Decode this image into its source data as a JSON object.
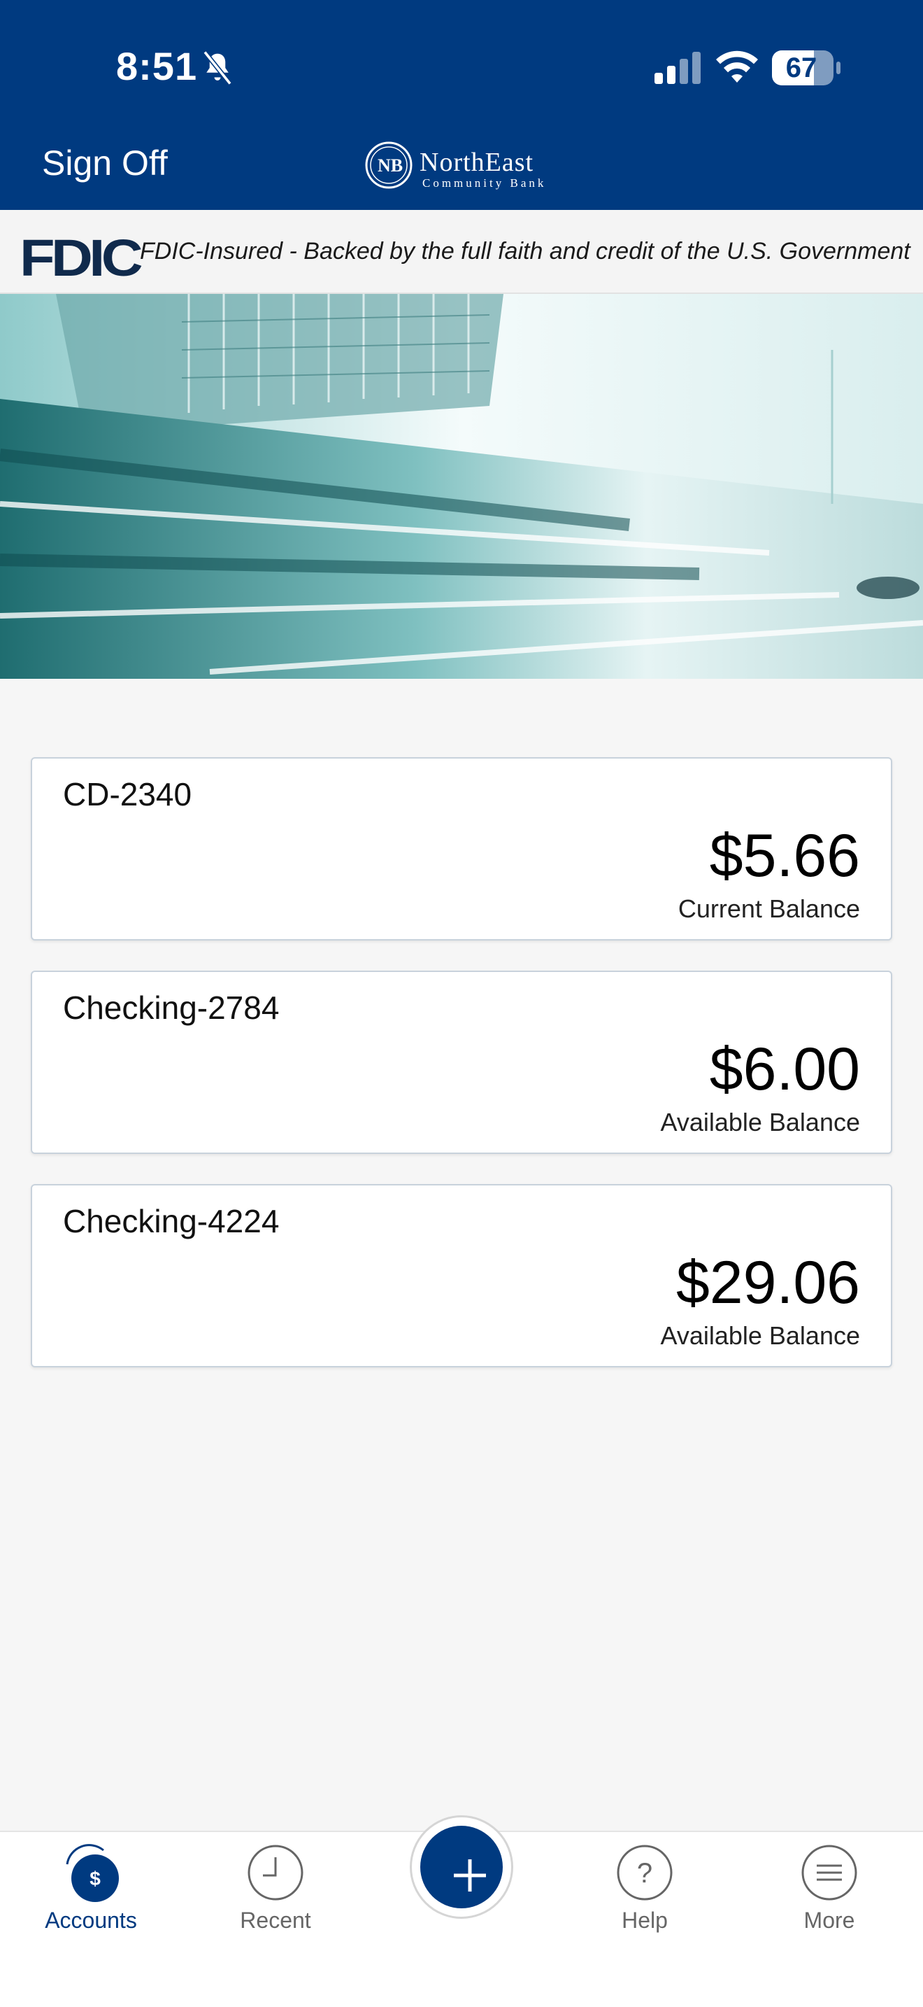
{
  "status_bar": {
    "time": "8:51",
    "battery": "67",
    "icons": [
      "bell-slash-icon",
      "cellular-signal-icon",
      "wifi-icon",
      "battery-icon"
    ]
  },
  "header": {
    "sign_off_label": "Sign Off",
    "logo_name": "NorthEast",
    "logo_subtitle": "Community Bank"
  },
  "fdic": {
    "logo": "FDIC",
    "text": "FDIC-Insured - Backed by the full faith and credit of the U.S. Government"
  },
  "accounts": [
    {
      "name": "CD-2340",
      "amount": "$5.66",
      "label": "Current Balance"
    },
    {
      "name": "Checking-2784",
      "amount": "$6.00",
      "label": "Available Balance"
    },
    {
      "name": "Checking-4224",
      "amount": "$29.06",
      "label": "Available Balance"
    }
  ],
  "tabbar": {
    "items": [
      {
        "label": "Accounts",
        "icon": "accounts-dollar-icon",
        "active": true
      },
      {
        "label": "Recent",
        "icon": "clock-icon",
        "active": false
      },
      {
        "label": "Help",
        "icon": "question-icon",
        "active": false
      },
      {
        "label": "More",
        "icon": "menu-icon",
        "active": false
      }
    ],
    "action_icon": "plus-icon"
  },
  "colors": {
    "brand": "#003a80",
    "background": "#f6f6f6",
    "card_border": "#c8d2dc"
  }
}
